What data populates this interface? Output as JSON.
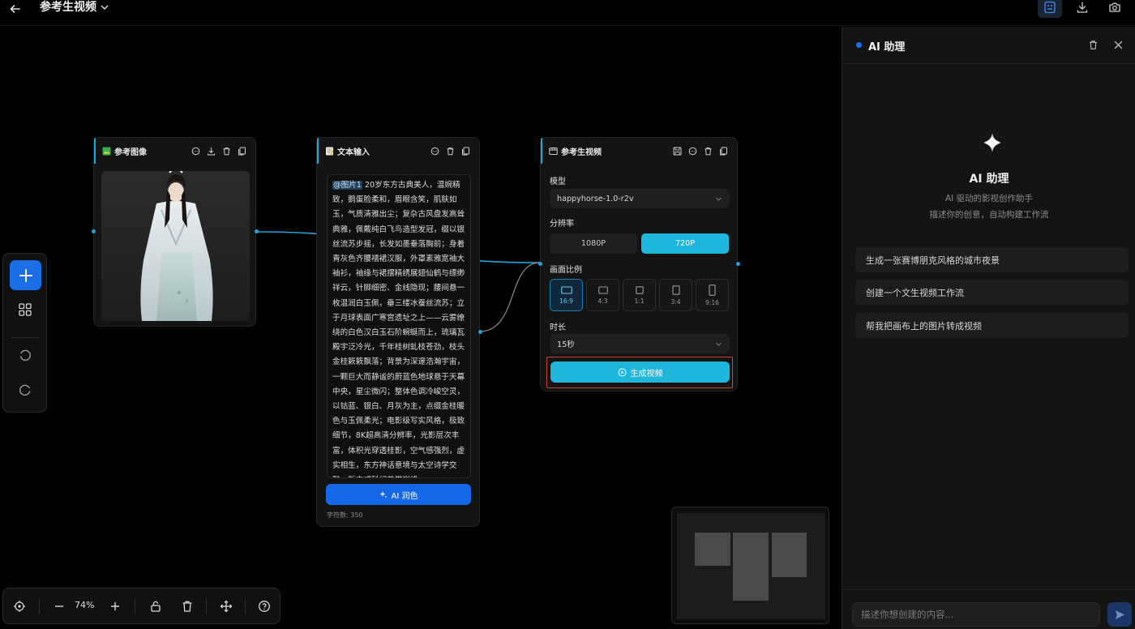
{
  "topbar": {
    "title": "参考生视频"
  },
  "nodes": {
    "image": {
      "title": "参考图像"
    },
    "text": {
      "title": "文本输入",
      "mention": "@图片1",
      "content": " 20岁东方古典美人，温婉精致，鹅蛋脸柔和，眉眼含笑，肌肤如玉，气质清雅出尘；复杂古风盘发高耸典雅，佩戴纯白飞鸟造型发冠，缀以银丝流苏步摇，长发如墨垂落胸前；身着青灰色齐腰襦裙汉服，外罩素雅宽袖大袖衫，袖缘与裙摆精绣展翅仙鹤与缥缈祥云，针脚细密、金线隐现；腰间悬一枚温润白玉佩，垂三缕冰蚕丝流苏；立于月球表面广寒宫遗址之上——云雾缭绕的白色汉白玉石阶蜿蜒而上，琉璃瓦殿宇泛冷光，千年桂树虬枝苍劲，枝头金桂簌簌飘落；背景为深邃浩瀚宇宙，一颗巨大而静谧的蔚蓝色地球悬于天幕中央，星尘微闪；整体色调冷峻空灵，以钴蓝、银白、月灰为主，点缀金桂暖色与玉佩柔光；电影级写实风格，极致细节，8K超高清分辨率，光影层次丰富，体积光穿透桂影，空气感强烈，虚实相生，东方神话意境与太空诗学交融，新中式科幻美学巅峰",
      "ai_button": "AI 润色",
      "char_count": "字符数: 350"
    },
    "video": {
      "title": "参考生视频",
      "model_label": "模型",
      "model_value": "happyhorse-1.0-r2v",
      "resolution_label": "分辨率",
      "resolution_options": [
        "1080P",
        "720P"
      ],
      "resolution_selected": "720P",
      "ratio_label": "画面比例",
      "ratios": [
        "16:9",
        "4:3",
        "1:1",
        "3:4",
        "9:16"
      ],
      "ratio_selected": "16:9",
      "duration_label": "时长",
      "duration_value": "15秒",
      "generate_button": "生成视频"
    }
  },
  "toolbar": {
    "zoom": "74%"
  },
  "panel": {
    "title": "AI 助理",
    "hero_title": "AI 助理",
    "subtitle_1": "AI 驱动的影视创作助手",
    "subtitle_2": "描述你的创意，自动构建工作流",
    "suggestions": [
      "生成一张赛博朋克风格的城市夜景",
      "创建一个文生视频工作流",
      "帮我把画布上的图片转成视频"
    ],
    "input_placeholder": "描述你想创建的内容..."
  },
  "colors": {
    "accent_blue": "#1a6fe8",
    "accent_cyan": "#1fb6dc",
    "highlight_red": "#c8423a"
  }
}
